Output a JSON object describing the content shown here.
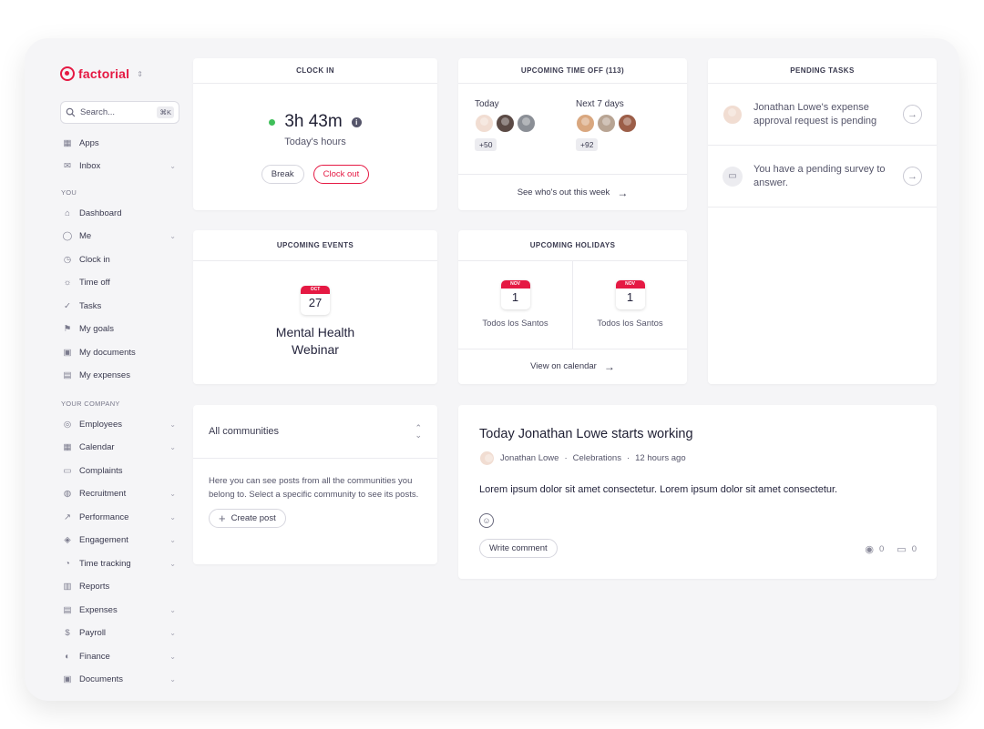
{
  "app": {
    "brand": "factorial",
    "accent": "#e51943"
  },
  "search": {
    "placeholder": "Search...",
    "shortcut": "⌘K"
  },
  "nav": {
    "top": [
      {
        "label": "Apps",
        "icon": "store-icon",
        "chevron": false
      },
      {
        "label": "Inbox",
        "icon": "inbox-icon",
        "chevron": true
      }
    ],
    "you_label": "YOU",
    "you": [
      {
        "label": "Dashboard",
        "icon": "home-icon",
        "chevron": false
      },
      {
        "label": "Me",
        "icon": "person-icon",
        "chevron": true
      },
      {
        "label": "Clock in",
        "icon": "clock-icon",
        "chevron": false
      },
      {
        "label": "Time off",
        "icon": "beach-icon",
        "chevron": false
      },
      {
        "label": "Tasks",
        "icon": "check-circle-icon",
        "chevron": false
      },
      {
        "label": "My goals",
        "icon": "flag-icon",
        "chevron": false
      },
      {
        "label": "My documents",
        "icon": "folder-icon",
        "chevron": false
      },
      {
        "label": "My expenses",
        "icon": "receipt-icon",
        "chevron": false
      }
    ],
    "company_label": "YOUR COMPANY",
    "company": [
      {
        "label": "Employees",
        "icon": "people-icon",
        "chevron": true
      },
      {
        "label": "Calendar",
        "icon": "calendar-icon",
        "chevron": true
      },
      {
        "label": "Complaints",
        "icon": "chat-icon",
        "chevron": false
      },
      {
        "label": "Recruitment",
        "icon": "search-person-icon",
        "chevron": true
      },
      {
        "label": "Performance",
        "icon": "chart-icon",
        "chevron": true
      },
      {
        "label": "Engagement",
        "icon": "engagement-icon",
        "chevron": true
      },
      {
        "label": "Time tracking",
        "icon": "stopwatch-icon",
        "chevron": true
      },
      {
        "label": "Reports",
        "icon": "report-icon",
        "chevron": false
      },
      {
        "label": "Expenses",
        "icon": "receipt-icon",
        "chevron": true
      },
      {
        "label": "Payroll",
        "icon": "money-icon",
        "chevron": true
      },
      {
        "label": "Finance",
        "icon": "bank-icon",
        "chevron": true
      },
      {
        "label": "Documents",
        "icon": "folder-icon",
        "chevron": true
      }
    ]
  },
  "clock_in": {
    "title": "CLOCK IN",
    "time": "3h 43m",
    "subtitle": "Today's hours",
    "break_label": "Break",
    "clock_out_label": "Clock out",
    "status_color": "#3fbf5a"
  },
  "time_off": {
    "title": "UPCOMING TIME OFF (113)",
    "today_label": "Today",
    "today_more": "+50",
    "next_label": "Next 7 days",
    "next_more": "+92",
    "link": "See who's out this week"
  },
  "pending_tasks": {
    "title": "PENDING TASKS",
    "items": [
      {
        "text": "Jonathan Lowe's expense approval request is pending"
      },
      {
        "text": "You have a pending survey to answer."
      }
    ]
  },
  "events": {
    "title": "UPCOMING EVENTS",
    "month": "OCT",
    "day": "27",
    "name": "Mental Health Webinar"
  },
  "holidays": {
    "title": "UPCOMING HOLIDAYS",
    "items": [
      {
        "month": "NOV",
        "day": "1",
        "name": "Todos los Santos"
      },
      {
        "month": "NOV",
        "day": "1",
        "name": "Todos los Santos"
      }
    ],
    "link": "View on calendar"
  },
  "communities": {
    "selector": "All communities",
    "description": "Here you can see posts from all the communities you belong to. Select a specific community to see its posts.",
    "create_label": "Create post"
  },
  "post": {
    "title": "Today Jonathan Lowe starts working",
    "author": "Jonathan Lowe",
    "category": "Celebrations",
    "time": "12 hours ago",
    "body": "Lorem ipsum dolor sit amet consectetur. Lorem ipsum dolor sit amet consectetur.",
    "comment_label": "Write comment",
    "views": "0",
    "comments": "0"
  }
}
